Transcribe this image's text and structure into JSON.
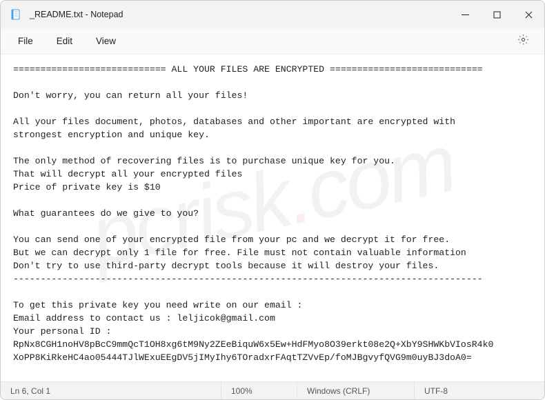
{
  "titlebar": {
    "title": "_README.txt - Notepad"
  },
  "menu": {
    "file": "File",
    "edit": "Edit",
    "view": "View"
  },
  "body": {
    "line1": "============================ ALL YOUR FILES ARE ENCRYPTED ============================",
    "line2": "",
    "line3": "Don't worry, you can return all your files!",
    "line4": "",
    "line5": "All your files document, photos, databases and other important are encrypted with",
    "line6": "strongest encryption and unique key.",
    "line7": "",
    "line8": "The only method of recovering files is to purchase unique key for you.",
    "line9": "That will decrypt all your encrypted files",
    "line10": "Price of private key is $10",
    "line11": "",
    "line12": "What guarantees do we give to you?",
    "line13": "",
    "line14": "You can send one of your encrypted file from your pc and we decrypt it for free.",
    "line15": "But we can decrypt only 1 file for free. File must not contain valuable information",
    "line16": "Don't try to use third-party decrypt tools because it will destroy your files.",
    "line17": "--------------------------------------------------------------------------------------",
    "line18": "",
    "line19": "To get this private key you need write on our email :",
    "line20": "Email address to contact us : leljicok@gmail.com",
    "line21": "Your personal ID :",
    "line22": "RpNx8CGH1noHV8pBcC9mmQcT1OH8xg6tM9Ny2ZEeBiquW6x5Ew+HdFMyo8O39erkt08e2Q+XbY9SHWKbVIosR4k0",
    "line23": "XoPP8KiRkeHC4ao05444TJlWExuEEgDV5jIMyIhy6TOradxrFAqtTZVvEp/foMJBgvyfQVG9m0uyBJ3doA0="
  },
  "statusbar": {
    "pos": "Ln 6, Col 1",
    "zoom": "100%",
    "lineending": "Windows (CRLF)",
    "encoding": "UTF-8"
  }
}
